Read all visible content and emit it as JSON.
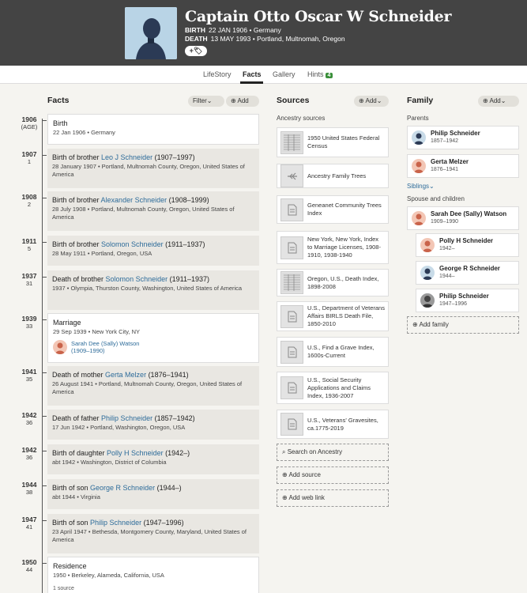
{
  "person": {
    "name": "Captain Otto Oscar W Schneider",
    "birth_label": "BIRTH",
    "birth_value": "22 JAN 1906 • Germany",
    "death_label": "DEATH",
    "death_value": "13 MAY 1993 • Portland, Multnomah, Oregon",
    "edit_label": "+🏷"
  },
  "tabs": [
    {
      "label": "LifeStory"
    },
    {
      "label": "Facts"
    },
    {
      "label": "Gallery"
    },
    {
      "label": "Hints",
      "badge": "4"
    }
  ],
  "facts": {
    "title": "Facts",
    "filter_label": "Filter⌄",
    "add_label": "⊕ Add",
    "items": [
      {
        "year": "1906",
        "age": "(AGE)",
        "title": "Birth",
        "link": "",
        "suffix": "",
        "detail": "22 Jan 1906 • Germany"
      },
      {
        "year": "1907",
        "age": "1",
        "title": "Birth of brother ",
        "link": "Leo J Schneider",
        "suffix": " (1907–1997)",
        "detail": "28 January 1907 • Portland, Multnomah County, Oregon, United States of America"
      },
      {
        "year": "1908",
        "age": "2",
        "title": "Birth of brother ",
        "link": "Alexander Schneider",
        "suffix": " (1908–1999)",
        "detail": "28 July 1908 • Portland, Multnomah County, Oregon, United States of America"
      },
      {
        "year": "1911",
        "age": "5",
        "title": "Birth of brother ",
        "link": "Solomon Schneider",
        "suffix": " (1911–1937)",
        "detail": "28 May 1911 • Portland, Oregon, USA"
      },
      {
        "year": "1937",
        "age": "31",
        "title": "Death of brother ",
        "link": "Solomon Schneider",
        "suffix": " (1911–1937)",
        "detail": "1937 • Olympia, Thurston County, Washington, United States of America"
      },
      {
        "year": "1939",
        "age": "33",
        "title": "Marriage",
        "link": "",
        "suffix": "",
        "detail": "29 Sep 1939 • New York City, NY",
        "spouse_name": "Sarah Dee (Sally) Watson",
        "spouse_dates": "(1909–1990)"
      },
      {
        "year": "1941",
        "age": "35",
        "title": "Death of mother ",
        "link": "Gerta Melzer",
        "suffix": " (1876–1941)",
        "detail": "26 August 1941 • Portland, Multnomah County, Oregon, United States of America"
      },
      {
        "year": "1942",
        "age": "36",
        "title": "Death of father ",
        "link": "Philip Schneider",
        "suffix": " (1857–1942)",
        "detail": "17 Jun 1942 • Portland, Washington, Oregon, USA"
      },
      {
        "year": "1942",
        "age": "36",
        "title": "Birth of daughter ",
        "link": "Polly H Schneider",
        "suffix": " (1942–)",
        "detail": "abt 1942 • Washington, District of Columbia"
      },
      {
        "year": "1944",
        "age": "38",
        "title": "Birth of son ",
        "link": "George R Schneider",
        "suffix": " (1944–)",
        "detail": "abt 1944 • Virginia"
      },
      {
        "year": "1947",
        "age": "41",
        "title": "Birth of son ",
        "link": "Philip Schneider",
        "suffix": " (1947–1996)",
        "detail": "23 April 1947 • Bethesda, Montgomery County, Maryland, United States of America"
      },
      {
        "year": "1950",
        "age": "44",
        "title": "Residence",
        "link": "",
        "suffix": "",
        "detail": "1950 • Berkeley, Alameda, California, USA",
        "sources": "1 source"
      }
    ]
  },
  "sources": {
    "title": "Sources",
    "add_label": "⊕ Add⌄",
    "subtitle": "Ancestry sources",
    "items": [
      {
        "text": "1950 United States Federal Census"
      },
      {
        "text": "Ancestry Family Trees"
      },
      {
        "text": "Geneanet Community Trees Index"
      },
      {
        "text": "New York, New York, Index to Marriage Licenses, 1908-1910, 1938-1940"
      },
      {
        "text": "Oregon, U.S., Death Index, 1898-2008"
      },
      {
        "text": "U.S., Department of Veterans Affairs BIRLS Death File, 1850-2010"
      },
      {
        "text": "U.S., Find a Grave Index, 1600s-Current"
      },
      {
        "text": "U.S., Social Security Applications and Claims Index, 1936-2007"
      },
      {
        "text": "U.S., Veterans' Gravesites, ca.1775-2019"
      }
    ],
    "search_label": "Search on Ancestry",
    "add_source_label": "Add source",
    "add_web_link_label": "Add web link"
  },
  "family": {
    "title": "Family",
    "add_label": "⊕ Add⌄",
    "parents_label": "Parents",
    "parents": [
      {
        "name": "Philip Schneider",
        "dates": "1857–1942",
        "gender": "m"
      },
      {
        "name": "Gerta Melzer",
        "dates": "1876–1941",
        "gender": "f"
      }
    ],
    "siblings_label": "Siblings⌄",
    "spouse_label": "Spouse and children",
    "spouse": {
      "name": "Sarah Dee (Sally) Watson",
      "dates": "1909–1990",
      "gender": "f"
    },
    "children": [
      {
        "name": "Polly H Schneider",
        "dates": "1942–",
        "gender": "f"
      },
      {
        "name": "George R Schneider",
        "dates": "1944–",
        "gender": "m"
      },
      {
        "name": "Philip Schneider",
        "dates": "1947–1996",
        "gender": "photo"
      }
    ],
    "add_family_label": "Add family"
  },
  "colors": {
    "header": "#444444",
    "link": "#2e6c9a",
    "badge": "#3a8f3a"
  }
}
